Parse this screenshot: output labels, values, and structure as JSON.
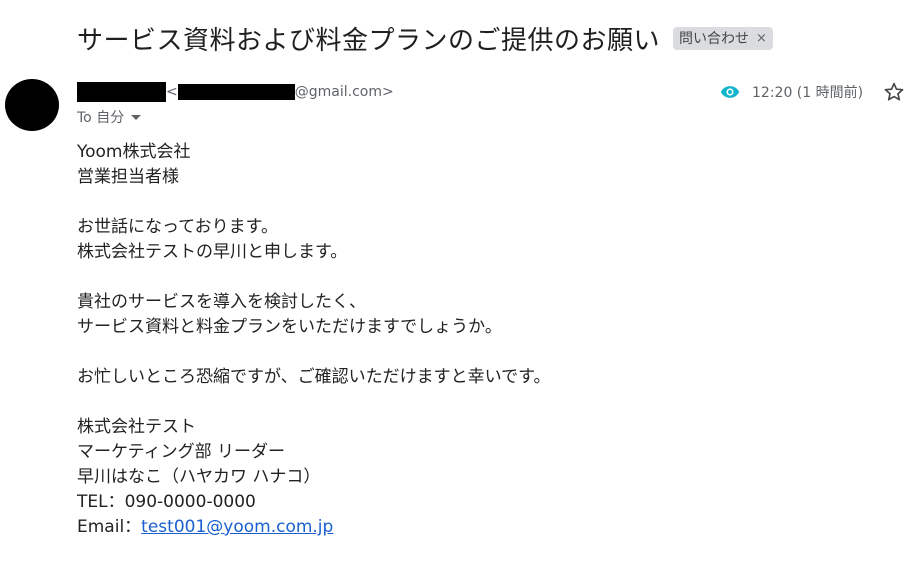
{
  "email": {
    "subject": "サービス資料および料金プランのご提供のお願い",
    "label": {
      "text": "問い合わせ",
      "close": "×"
    },
    "sender": {
      "open_angle": "<",
      "email_domain": "@gmail.com>"
    },
    "recipient": {
      "text": "To 自分"
    },
    "time": "12:20 (1 時間前)",
    "body": {
      "company": "Yoom株式会社",
      "recipient_title": "営業担当者様",
      "greeting": "お世話になっております。",
      "intro": "株式会社テストの早川と申します。",
      "request_line1": "貴社のサービスを導入を検討したく、",
      "request_line2": "サービス資料と料金プランをいただけますでしょうか。",
      "closing": "お忙しいところ恐縮ですが、ご確認いただけますと幸いです。",
      "sig_company": "株式会社テスト",
      "sig_department": "マーケティング部 リーダー",
      "sig_name": "早川はなこ（ハヤカワ ハナコ）",
      "sig_tel": "TEL：090-0000-0000",
      "sig_email_label": "Email：",
      "sig_email_link": "test001@yoom.com.jp"
    }
  },
  "colors": {
    "accent_eye": "#12b5cb",
    "link": "#1a5fd0",
    "chip_bg": "#dadce0",
    "avatar": "#000000"
  },
  "icons": {
    "eye": "eye-icon",
    "star": "star-icon",
    "dropdown": "chevron-down-icon",
    "remove_label": "close-icon"
  }
}
